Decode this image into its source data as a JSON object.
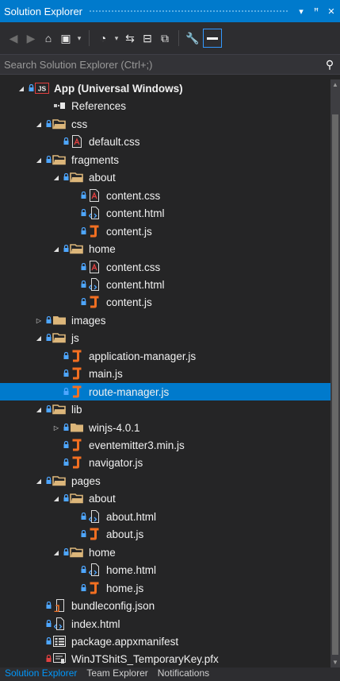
{
  "window": {
    "title": "Solution Explorer",
    "buttons": [
      {
        "name": "dropdown-arrow-icon",
        "glyph": "▾"
      },
      {
        "name": "pin-icon",
        "glyph": "ꟸ"
      },
      {
        "name": "close-icon",
        "glyph": "✕"
      }
    ]
  },
  "toolbar": {
    "tools": [
      {
        "name": "back-icon",
        "glyph": "◀",
        "dim": true
      },
      {
        "name": "forward-icon",
        "glyph": "▶",
        "dim": true
      },
      {
        "name": "home-icon",
        "glyph": "⌂"
      },
      {
        "name": "switch-views-icon",
        "glyph": "▣"
      },
      {
        "name": "switch-views-dropdown-icon",
        "glyph": "▾",
        "small": true
      },
      {
        "sep": true
      },
      {
        "name": "pending-changes-icon",
        "glyph": "◔"
      },
      {
        "name": "pending-changes-dropdown-icon",
        "glyph": "▾",
        "small": true
      },
      {
        "name": "sync-icon",
        "glyph": "⇆"
      },
      {
        "name": "collapse-all-icon",
        "glyph": "⊟"
      },
      {
        "name": "show-all-files-icon",
        "glyph": "⧉"
      },
      {
        "sep": true
      },
      {
        "name": "properties-wrench-icon",
        "glyph": "🔧"
      },
      {
        "name": "preview-selected-icon",
        "active": true
      }
    ]
  },
  "search": {
    "placeholder": "Search Solution Explorer (Ctrl+;)",
    "value": ""
  },
  "tree": [
    {
      "label": "App (Universal Windows)",
      "depth": 0,
      "expander": "expanded",
      "icon": "project",
      "lock": true,
      "bold": true
    },
    {
      "label": "References",
      "depth": 1,
      "expander": "none",
      "icon": "references",
      "lock": false
    },
    {
      "label": "css",
      "depth": 1,
      "expander": "expanded",
      "icon": "folder-open",
      "lock": true
    },
    {
      "label": "default.css",
      "depth": 2,
      "expander": "none",
      "icon": "css",
      "lock": true
    },
    {
      "label": "fragments",
      "depth": 1,
      "expander": "expanded",
      "icon": "folder-open",
      "lock": true
    },
    {
      "label": "about",
      "depth": 2,
      "expander": "expanded",
      "icon": "folder-open",
      "lock": true
    },
    {
      "label": "content.css",
      "depth": 3,
      "expander": "none",
      "icon": "css",
      "lock": true
    },
    {
      "label": "content.html",
      "depth": 3,
      "expander": "none",
      "icon": "html",
      "lock": true
    },
    {
      "label": "content.js",
      "depth": 3,
      "expander": "none",
      "icon": "js",
      "lock": true
    },
    {
      "label": "home",
      "depth": 2,
      "expander": "expanded",
      "icon": "folder-open",
      "lock": true
    },
    {
      "label": "content.css",
      "depth": 3,
      "expander": "none",
      "icon": "css",
      "lock": true
    },
    {
      "label": "content.html",
      "depth": 3,
      "expander": "none",
      "icon": "html",
      "lock": true
    },
    {
      "label": "content.js",
      "depth": 3,
      "expander": "none",
      "icon": "js",
      "lock": true
    },
    {
      "label": "images",
      "depth": 1,
      "expander": "collapsed",
      "icon": "folder-closed",
      "lock": true
    },
    {
      "label": "js",
      "depth": 1,
      "expander": "expanded",
      "icon": "folder-open",
      "lock": true
    },
    {
      "label": "application-manager.js",
      "depth": 2,
      "expander": "none",
      "icon": "js",
      "lock": true
    },
    {
      "label": "main.js",
      "depth": 2,
      "expander": "none",
      "icon": "js",
      "lock": true
    },
    {
      "label": "route-manager.js",
      "depth": 2,
      "expander": "none",
      "icon": "js",
      "lock": true,
      "selected": true
    },
    {
      "label": "lib",
      "depth": 1,
      "expander": "expanded",
      "icon": "folder-open",
      "lock": true
    },
    {
      "label": "winjs-4.0.1",
      "depth": 2,
      "expander": "collapsed",
      "icon": "folder-closed",
      "lock": true
    },
    {
      "label": "eventemitter3.min.js",
      "depth": 2,
      "expander": "none",
      "icon": "js",
      "lock": true
    },
    {
      "label": "navigator.js",
      "depth": 2,
      "expander": "none",
      "icon": "js",
      "lock": true
    },
    {
      "label": "pages",
      "depth": 1,
      "expander": "expanded",
      "icon": "folder-open",
      "lock": true
    },
    {
      "label": "about",
      "depth": 2,
      "expander": "expanded",
      "icon": "folder-open",
      "lock": true
    },
    {
      "label": "about.html",
      "depth": 3,
      "expander": "none",
      "icon": "html",
      "lock": true
    },
    {
      "label": "about.js",
      "depth": 3,
      "expander": "none",
      "icon": "js",
      "lock": true
    },
    {
      "label": "home",
      "depth": 2,
      "expander": "expanded",
      "icon": "folder-open",
      "lock": true
    },
    {
      "label": "home.html",
      "depth": 3,
      "expander": "none",
      "icon": "html",
      "lock": true
    },
    {
      "label": "home.js",
      "depth": 3,
      "expander": "none",
      "icon": "js",
      "lock": true
    },
    {
      "label": "bundleconfig.json",
      "depth": 1,
      "expander": "none",
      "icon": "json",
      "lock": true
    },
    {
      "label": "index.html",
      "depth": 1,
      "expander": "none",
      "icon": "html",
      "lock": true
    },
    {
      "label": "package.appxmanifest",
      "depth": 1,
      "expander": "none",
      "icon": "manifest",
      "lock": true
    },
    {
      "label": "WinJTShitS_TemporaryKey.pfx",
      "depth": 1,
      "expander": "none",
      "icon": "certificate",
      "lock": true,
      "lock_color": "red"
    }
  ],
  "bottom_tabs": [
    {
      "label": "Solution Explorer",
      "active": true
    },
    {
      "label": "Team Explorer",
      "active": false
    },
    {
      "label": "Notifications",
      "active": false
    }
  ],
  "colors": {
    "accent": "#007acc",
    "background": "#252526",
    "folder": "#dcb67a",
    "js_orange": "#f26f21",
    "lock_blue": "#4ea6ff"
  }
}
